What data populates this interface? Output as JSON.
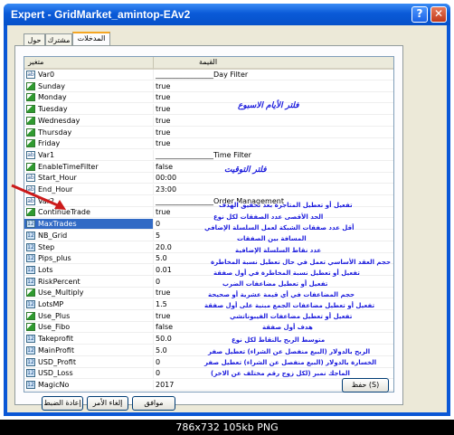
{
  "window": {
    "title": "Expert - GridMarket_amintop-EAv2",
    "help": "?",
    "close": "✕"
  },
  "tabs": [
    {
      "label": "حول"
    },
    {
      "label": "مشترك"
    },
    {
      "label": "المدخلات"
    }
  ],
  "table": {
    "col_name": "متغير",
    "col_value": "القيمة",
    "rows": [
      {
        "name": "Var0",
        "value": "________________Day Filter",
        "icon": "str"
      },
      {
        "name": "Sunday",
        "value": "true",
        "icon": "bool"
      },
      {
        "name": "Monday",
        "value": "true",
        "icon": "bool"
      },
      {
        "name": "Tuesday",
        "value": "true",
        "icon": "bool"
      },
      {
        "name": "Wednesday",
        "value": "true",
        "icon": "bool"
      },
      {
        "name": "Thursday",
        "value": "true",
        "icon": "bool"
      },
      {
        "name": "Friday",
        "value": "true",
        "icon": "bool"
      },
      {
        "name": "Var1",
        "value": "________________Time Filter",
        "icon": "str"
      },
      {
        "name": "EnableTimeFilter",
        "value": "false",
        "icon": "bool"
      },
      {
        "name": "Start_Hour",
        "value": "00:00",
        "icon": "str"
      },
      {
        "name": "End_Hour",
        "value": "23:00",
        "icon": "str"
      },
      {
        "name": "Var2",
        "value": "________________Order Management",
        "icon": "str"
      },
      {
        "name": "ContinueTrade",
        "value": "true",
        "icon": "bool"
      },
      {
        "name": "MaxTrades",
        "value": "0",
        "icon": "num",
        "selected": true
      },
      {
        "name": "NB_Grid",
        "value": "5",
        "icon": "num"
      },
      {
        "name": "Step",
        "value": "20.0",
        "icon": "num"
      },
      {
        "name": "Pips_plus",
        "value": "5.0",
        "icon": "num"
      },
      {
        "name": "Lots",
        "value": "0.01",
        "icon": "num"
      },
      {
        "name": "RiskPercent",
        "value": "0",
        "icon": "num"
      },
      {
        "name": "Use_Multiply",
        "value": "true",
        "icon": "bool"
      },
      {
        "name": "LotsMP",
        "value": "1.5",
        "icon": "num"
      },
      {
        "name": "Use_Plus",
        "value": "true",
        "icon": "bool"
      },
      {
        "name": "Use_Fibo",
        "value": "false",
        "icon": "bool"
      },
      {
        "name": "Takeprofit",
        "value": "50.0",
        "icon": "num"
      },
      {
        "name": "MainProfit",
        "value": "5.0",
        "icon": "num"
      },
      {
        "name": "USD_Profit",
        "value": "0",
        "icon": "num"
      },
      {
        "name": "USD_Loss",
        "value": "0",
        "icon": "num"
      },
      {
        "name": "MagicNo",
        "value": "2017",
        "icon": "num"
      }
    ]
  },
  "annotations": {
    "day_filter": "فلتر الأيام الاسبوع",
    "time_filter": "فلتر التوقيت",
    "continue_trade": "تفعيل أو تعطيل المتاجرة بعد تحقيق الهدف",
    "max_trades": "الحد الأقصى عدد الصفقات لكل نوع",
    "nb_grid": "أقل عدد صفقات الشبكة لعمل السلسلة الإضافي",
    "step": "المسافة بين الصفقات",
    "pips_plus": "عدد نقاط السلسلة الإضافية",
    "lots": "حجم العقد الأساسي تعمل في حال تعطيل نسبة المخاطرة",
    "risk": "تفعيل أو تعطيل نسبة المخاطرة في أول صفقة",
    "use_multiply": "تفعيل أو تعطيل مضاعفات الضرب",
    "lots_mp": "حجم المضاعفات في أي قيمة عشرية أو صحيحة",
    "use_plus": "تفعيل أو تعطيل مضاعفات الجمع مبنية على أول صفقة",
    "use_fibo": "تفعيل أو تعطيل مضاعفات الفيبوناتشي",
    "takeprofit": "هدف أول صفقة",
    "main_profit": "متوسط الربح بالنقاط لكل نوع",
    "usd_profit": "الربح بالدولار (البيع منفصل عن الشراء) تعطيل صفر",
    "usd_loss": "الخسارة بالدولار (البيع منفصل عن الشراء) تعطيل صفر",
    "magic": "الماجك نمبر (لكل زوج رقم مختلف عن الاخر)"
  },
  "buttons": {
    "save": "حفظ (S)",
    "ok": "موافق",
    "cancel": "إلغاء الأمر",
    "reset": "إعادة الضبط"
  },
  "caption": "786x732  105kb  PNG",
  "colors": {
    "title_bar": "#0a57d6",
    "annotation": "#1a1adc",
    "arrow": "#cc1a1a",
    "selection": "#316ac5"
  }
}
